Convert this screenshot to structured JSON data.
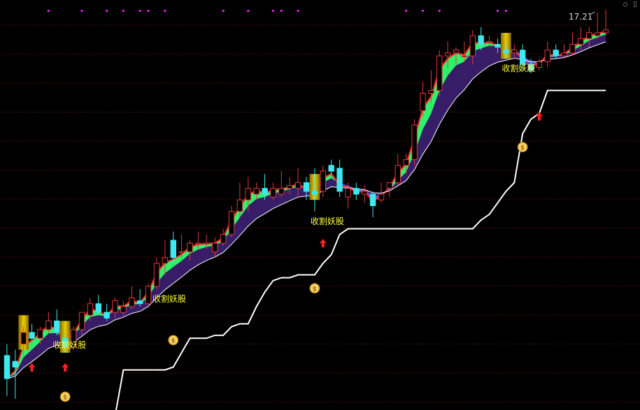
{
  "chart_data": {
    "type": "candlestick",
    "last_price_label": "17.21",
    "signal_text": "收割妖股",
    "grid": true,
    "colors": {
      "background": "#000000",
      "grid": "#8b1a1a",
      "up_candle": "#e03a3a",
      "down_candle": "#3fe8f0",
      "highlight_bar": "#e8d000",
      "green_band": "#31f06a",
      "purple_band": "#3a1f6e",
      "violet_band": "#5c5ce0",
      "red_line": "#ff2020",
      "stop_line": "#ffffff",
      "label_text": "#ffff40",
      "price_text": "#d8d8d8",
      "signal_arrow": "#ff2020",
      "magenta_dot": "#e020e0"
    },
    "yrange": [
      4.4,
      18.0
    ],
    "candles": [
      [
        6.0,
        6.4,
        4.6,
        5.2
      ],
      [
        5.8,
        6.2,
        4.5,
        5.6
      ],
      [
        6.4,
        7.0,
        6.2,
        6.8
      ],
      [
        6.8,
        7.1,
        6.5,
        6.6
      ],
      [
        6.6,
        7.0,
        6.4,
        6.9
      ],
      [
        6.9,
        7.5,
        6.8,
        7.2
      ],
      [
        7.2,
        7.6,
        6.7,
        6.8
      ],
      [
        6.6,
        6.8,
        6.1,
        6.3
      ],
      [
        6.3,
        7.0,
        6.2,
        6.9
      ],
      [
        6.9,
        7.5,
        6.7,
        7.5
      ],
      [
        7.4,
        8.0,
        7.2,
        7.8
      ],
      [
        7.8,
        8.1,
        7.4,
        7.5
      ],
      [
        7.5,
        7.8,
        7.2,
        7.3
      ],
      [
        7.5,
        8.0,
        7.3,
        7.9
      ],
      [
        7.5,
        7.9,
        7.3,
        7.7
      ],
      [
        7.7,
        8.4,
        7.6,
        8.0
      ],
      [
        7.9,
        8.3,
        7.7,
        7.8
      ],
      [
        7.8,
        8.5,
        7.7,
        8.4
      ],
      [
        8.4,
        9.4,
        8.3,
        9.2
      ],
      [
        9.2,
        10.0,
        8.8,
        9.4
      ],
      [
        10.0,
        10.3,
        9.2,
        9.4
      ],
      [
        9.6,
        10.2,
        9.4,
        9.6
      ],
      [
        9.6,
        10.0,
        9.3,
        9.9
      ],
      [
        9.9,
        10.3,
        9.7,
        9.9
      ],
      [
        9.9,
        10.2,
        9.7,
        9.9
      ],
      [
        9.6,
        10.1,
        9.4,
        9.9
      ],
      [
        9.9,
        10.4,
        9.8,
        10.2
      ],
      [
        10.2,
        11.2,
        10.1,
        11.0
      ],
      [
        11.0,
        12.0,
        10.8,
        11.4
      ],
      [
        11.4,
        12.2,
        11.0,
        11.8
      ],
      [
        11.6,
        12.0,
        11.4,
        11.8
      ],
      [
        11.8,
        12.3,
        11.4,
        11.6
      ],
      [
        11.5,
        12.0,
        11.4,
        11.8
      ],
      [
        11.6,
        12.4,
        11.5,
        11.8
      ],
      [
        11.8,
        12.2,
        11.6,
        11.9
      ],
      [
        11.8,
        12.5,
        11.5,
        12.0
      ],
      [
        12.0,
        12.2,
        11.4,
        11.7
      ],
      [
        11.7,
        12.5,
        11.0,
        11.6
      ],
      [
        11.7,
        12.6,
        11.5,
        12.4
      ],
      [
        12.6,
        12.8,
        12.3,
        12.4
      ],
      [
        12.5,
        12.8,
        11.5,
        11.7
      ],
      [
        11.5,
        12.0,
        11.1,
        11.8
      ],
      [
        11.8,
        12.0,
        11.4,
        11.6
      ],
      [
        11.6,
        11.9,
        11.3,
        11.7
      ],
      [
        11.6,
        11.7,
        10.8,
        11.2
      ],
      [
        11.4,
        12.0,
        11.3,
        11.6
      ],
      [
        11.8,
        12.0,
        11.5,
        12.0
      ],
      [
        12.0,
        13.0,
        11.9,
        12.6
      ],
      [
        12.6,
        13.0,
        12.3,
        12.8
      ],
      [
        12.8,
        14.2,
        12.6,
        14.0
      ],
      [
        14.5,
        15.5,
        14.3,
        15.1
      ],
      [
        15.1,
        15.9,
        14.8,
        15.2
      ],
      [
        15.2,
        16.6,
        15.0,
        16.4
      ],
      [
        16.4,
        16.9,
        16.0,
        16.5
      ],
      [
        16.5,
        16.7,
        16.1,
        16.6
      ],
      [
        16.4,
        16.9,
        16.2,
        16.4
      ],
      [
        16.4,
        17.3,
        16.1,
        17.1
      ],
      [
        17.1,
        17.4,
        16.6,
        16.8
      ],
      [
        16.9,
        17.1,
        16.7,
        16.9
      ],
      [
        16.8,
        17.0,
        16.5,
        16.7
      ],
      [
        16.6,
        16.8,
        16.3,
        16.5
      ],
      [
        16.5,
        16.8,
        16.3,
        16.6
      ],
      [
        16.6,
        16.8,
        15.9,
        16.1
      ],
      [
        16.1,
        16.3,
        15.8,
        15.9
      ],
      [
        16.0,
        16.3,
        15.9,
        16.2
      ],
      [
        16.2,
        16.9,
        16.0,
        16.6
      ],
      [
        16.6,
        16.8,
        16.3,
        16.4
      ],
      [
        16.4,
        16.8,
        16.3,
        16.5
      ],
      [
        16.5,
        17.2,
        16.4,
        16.8
      ],
      [
        16.8,
        17.4,
        16.6,
        17.0
      ],
      [
        17.0,
        17.4,
        16.7,
        17.21
      ],
      [
        17.1,
        17.9,
        17.0,
        17.2
      ],
      [
        17.2,
        18.0,
        17.1,
        17.3
      ]
    ],
    "signal_labels": [
      {
        "index": 6
      },
      {
        "index": 18
      },
      {
        "index": 37
      },
      {
        "index": 60
      }
    ],
    "buy_arrows": [
      3,
      7,
      38,
      64
    ],
    "money_bag_icons": [
      7,
      20,
      37,
      62
    ],
    "yellow_bars": [
      2,
      7,
      37,
      60
    ]
  },
  "corner_icons": {
    "diamond": "◇",
    "expand": "▯"
  }
}
